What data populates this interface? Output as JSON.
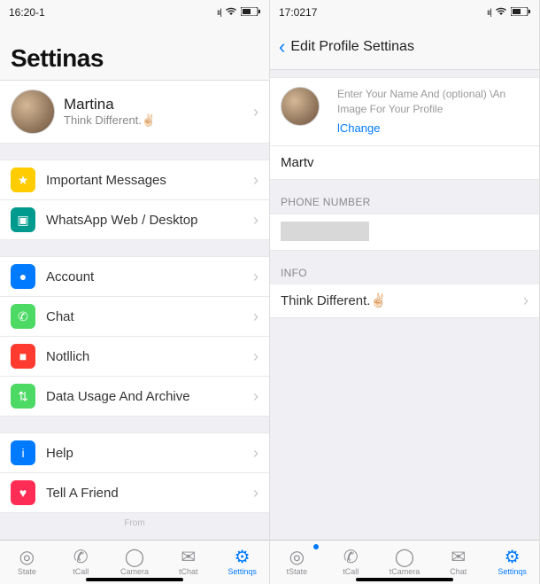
{
  "left": {
    "status": {
      "time": "16:20-1"
    },
    "title": "Settinas",
    "profile": {
      "name": "Martina",
      "status": "Think Different.✌🏻"
    },
    "items1": [
      {
        "label": "Important Messages",
        "icon": "star",
        "color": "#ffcc00"
      },
      {
        "label": "WhatsApp Web / Desktop",
        "icon": "desktop",
        "color": "#009b8e"
      }
    ],
    "items2": [
      {
        "label": "Account",
        "icon": "key",
        "color": "#007aff"
      },
      {
        "label": "Chat",
        "icon": "chat",
        "color": "#4cd964"
      },
      {
        "label": "Notllich",
        "icon": "bell",
        "color": "#ff3b30"
      },
      {
        "label": "Data Usage And Archive",
        "icon": "data",
        "color": "#4cd964"
      }
    ],
    "items3": [
      {
        "label": "Help",
        "icon": "info",
        "color": "#007aff"
      },
      {
        "label": "Tell A Friend",
        "icon": "heart",
        "color": "#ff2d55"
      }
    ],
    "footer": "From",
    "tabs": [
      {
        "label": "State",
        "icon": "◎"
      },
      {
        "label": "tCall",
        "icon": "✆"
      },
      {
        "label": "Camera",
        "icon": "◯"
      },
      {
        "label": "tChat",
        "icon": "✉"
      },
      {
        "label": "Settinqs",
        "icon": "⚙",
        "active": true
      }
    ]
  },
  "right": {
    "status": {
      "time": "17:0217"
    },
    "title": "Edit Profile Settinas",
    "hint": "Enter Your Name And (optional) \\An Image For Your Profile",
    "change": "lChange",
    "name": "Martv",
    "phone_label": "PHONE NUMBER",
    "info_label": "INFO",
    "info_value": "Think Different.✌🏻",
    "tabs": [
      {
        "label": "tState",
        "icon": "◎",
        "dot": true
      },
      {
        "label": "tCall",
        "icon": "✆"
      },
      {
        "label": "tCamera",
        "icon": "◯"
      },
      {
        "label": "Chat",
        "icon": "✉"
      },
      {
        "label": "Settinqs",
        "icon": "⚙",
        "active": true
      }
    ]
  },
  "glyphs": {
    "star": "★",
    "desktop": "▣",
    "key": "●",
    "chat": "✆",
    "bell": "■",
    "data": "⇅",
    "info": "i",
    "heart": "♥"
  }
}
